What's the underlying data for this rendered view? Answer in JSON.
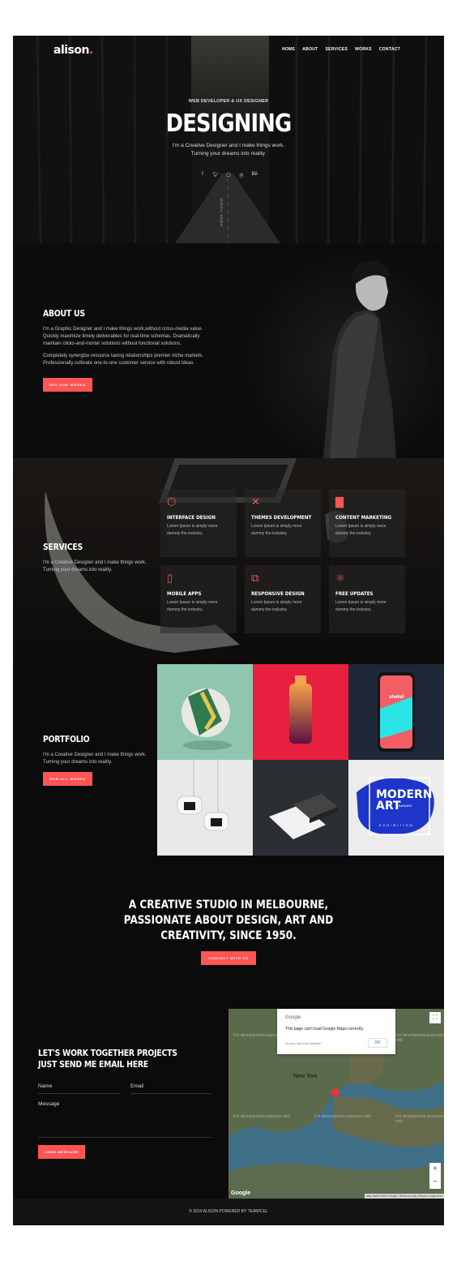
{
  "brand": {
    "logo": "alison",
    "logo_dot": "."
  },
  "nav": [
    "HOME",
    "ABOUT",
    "SERVICES",
    "WORKS",
    "CONTACT"
  ],
  "hero": {
    "subtitle": "WEB DEVELOPER & UX DESIGNER",
    "title": "DESIGNING",
    "text_line1": "I'm a Creative Designer and I make things work.",
    "text_line2": "Turning your dreams into reality.",
    "socials": [
      "facebook-icon",
      "twitter-icon",
      "instagram-icon",
      "pinterest-icon",
      "behance-icon"
    ],
    "scroll_label": "SCROLL DOWN"
  },
  "about": {
    "title": "ABOUT US",
    "p1": "I'm a Graphic Designer and I make things work,without cross-media value. Quickly maximize timely deliverables for real-time schemas. Dramatically maintain clicks-and-mortar solutions without functional solutions.",
    "p2": "Completely synergize resource taxing relationships premier niche markets. Professionally cultivate one-to-one customer service with robust ideas.",
    "button": "SEE OUR WORKS"
  },
  "services": {
    "title": "SERVICES",
    "text_line1": "I'm a Creative Designer and I make things work.",
    "text_line2": "Turning your dreams into reality.",
    "items": [
      {
        "title": "INTERFACE DESIGN",
        "desc": "Lorem Ipsum is simply more dummy the industry.",
        "icon": "cube-icon"
      },
      {
        "title": "THEMES DEVELOPMENT",
        "desc": "Lorem Ipsum is simply more dummy the industry.",
        "icon": "pencil-ruler-icon"
      },
      {
        "title": "CONTENT MARKETING",
        "desc": "Lorem Ipsum is simply more dummy the industry.",
        "icon": "bar-chart-icon"
      },
      {
        "title": "MOBILE APPS",
        "desc": "Lorem Ipsum is simply more dummy the industry.",
        "icon": "mobile-icon"
      },
      {
        "title": "RESPONSIVE DESIGN",
        "desc": "Lorem Ipsum is simply more dummy the industry.",
        "icon": "bicycle-icon"
      },
      {
        "title": "FREE UPDATES",
        "desc": "Lorem Ipsum is simply more dummy the industry.",
        "icon": "atom-icon"
      }
    ]
  },
  "portfolio": {
    "title": "PORTFOLIO",
    "text_line1": "I'm a Creative Designer and I make things work.",
    "text_line2": "Turning your dreams into reality.",
    "button": "OUR ALL WORKS",
    "phone_text": "shekel",
    "art_line1": "MODERN",
    "art_line2": "ART",
    "art_small": "BANNED",
    "art_exhibit": "EXHIBITION"
  },
  "cta": {
    "line1": "A CREATIVE STUDIO IN MELBOURNE,",
    "line2": "PASSIONATE ABOUT DESIGN, ART AND",
    "line3": "CREATIVITY, SINCE 1950.",
    "button": "CONTACT WITH US"
  },
  "contact": {
    "title_line1": "LET'S WORK TOGETHER PROJECTS",
    "title_line2": "JUST SEND ME EMAIL HERE",
    "name_placeholder": "Name",
    "email_placeholder": "Email",
    "message_placeholder": "Message",
    "button": "SEND MESSAGE"
  },
  "map": {
    "dialog_brand": "Google",
    "dialog_text": "This page can't load Google Maps correctly.",
    "dialog_link": "Do you own this website?",
    "dialog_ok": "OK",
    "watermark": "For development purposes only",
    "city": "New York",
    "google": "Google",
    "attribution": "Map data ©2019 Google | Terms of Use | Report a map error"
  },
  "footer": {
    "text": "© 2019 ALISON POWERED BY TEAMICEL"
  },
  "colors": {
    "accent": "#ff5555",
    "background": "#0b0b0b"
  }
}
